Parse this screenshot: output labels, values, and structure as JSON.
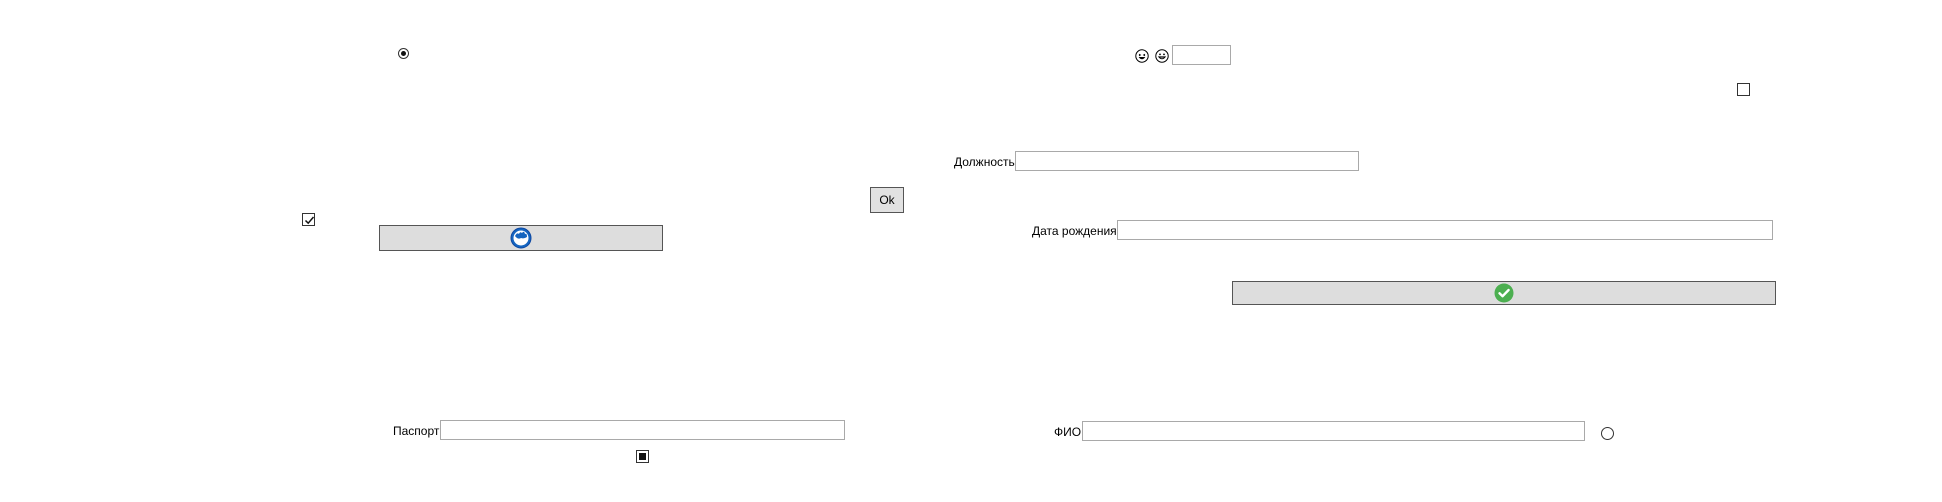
{
  "top_smileys": {
    "icons": [
      "laughing-face-icon",
      "grinning-face-icon"
    ],
    "input_value": ""
  },
  "buttons": {
    "ok_label": "Ok",
    "wide_button_1_icon": "blue-globe-icon",
    "wide_button_2_icon": "green-check-circle-icon"
  },
  "fields": {
    "position_label": "Должность",
    "position_value": "",
    "birth_date_label": "Дата рождения",
    "birth_date_value": "",
    "passport_label": "Паспорт",
    "passport_value": "",
    "full_name_label": "ФИО",
    "full_name_value": ""
  },
  "controls": {
    "radio_top_checked": true,
    "radio_bottom_checked": false,
    "checkbox_left_checked": true,
    "checkbox_right_checked": false,
    "checkbox_bottom_state": "indeterminate"
  },
  "colors": {
    "button_bg": "#dddddd",
    "globe_blue": "#1565c0",
    "check_green": "#4caf50",
    "field_border": "#a9a9a9"
  }
}
